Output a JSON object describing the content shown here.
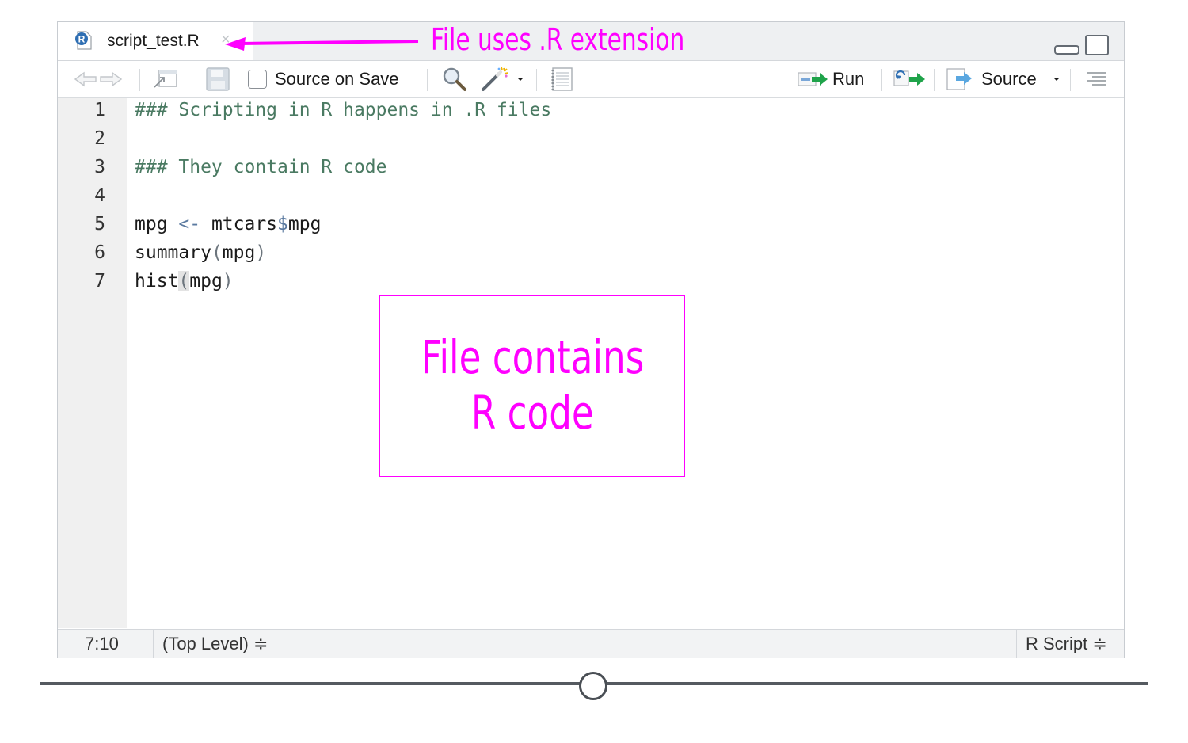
{
  "editor": {
    "tab": {
      "title": "script_test.R",
      "file_icon": "r-file-icon",
      "close_icon": "close-icon"
    },
    "window_controls": [
      "minimize-icon",
      "maximize-icon"
    ],
    "toolbar": {
      "source_on_save_label": "Source on Save",
      "source_on_save_checked": false,
      "run_label": "Run",
      "source_label": "Source",
      "icons": [
        "back-arrow-icon",
        "forward-arrow-icon",
        "show-in-window-icon",
        "save-icon",
        "search-icon",
        "code-tools-wand-icon",
        "compile-report-icon",
        "rerun-icon",
        "outline-icon"
      ]
    },
    "lines": [
      {
        "number": "1",
        "text": "### Scripting in R happens in .R files"
      },
      {
        "number": "2",
        "text": ""
      },
      {
        "number": "3",
        "text": "### They contain R code"
      },
      {
        "number": "4",
        "text": ""
      },
      {
        "number": "5",
        "text": "mpg <- mtcars$mpg",
        "parts": [
          "mpg ",
          "<-",
          " mtcars",
          "$",
          "mpg"
        ]
      },
      {
        "number": "6",
        "text": "summary(mpg)",
        "parts": [
          "summary",
          "(",
          "mpg",
          ")"
        ]
      },
      {
        "number": "7",
        "text": "hist(mpg)",
        "parts": [
          "hist",
          "(",
          "mpg",
          ")"
        ]
      }
    ],
    "status": {
      "cursor_position": "7:10",
      "scope": "(Top Level) ≑",
      "file_type": "R Script ≑"
    },
    "colors": {
      "comment": "#4a7a62",
      "annotation": "#ff00ff"
    }
  },
  "annotations": {
    "extension_note": "File uses .R extension",
    "box_line1": "File contains",
    "box_line2": "R code"
  }
}
